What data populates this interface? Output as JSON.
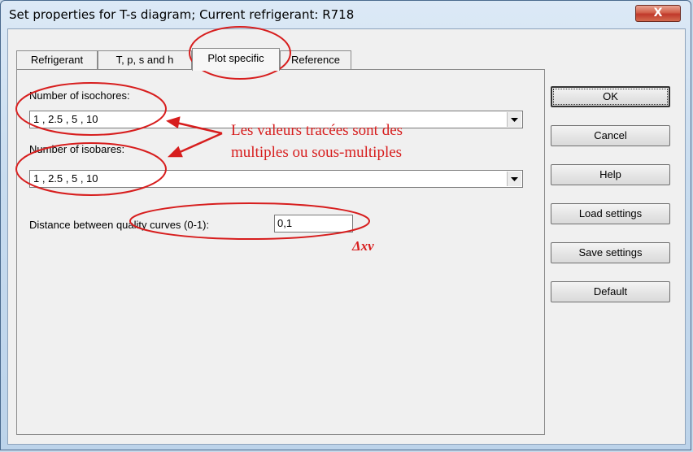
{
  "window": {
    "title": "Set properties for T-s diagram; Current refrigerant: R718",
    "close_glyph": "X"
  },
  "tabs": [
    {
      "label": "Refrigerant"
    },
    {
      "label": "T, p, s and h"
    },
    {
      "label": "Plot specific"
    },
    {
      "label": "Reference"
    }
  ],
  "panel": {
    "isochores_label": "Number of isochores:",
    "isochores_value": "1 , 2.5 , 5 , 10",
    "isobares_label": "Number of isobares:",
    "isobares_value": "1 , 2.5 , 5 , 10",
    "quality_label": "Distance between quality curves (0-1):",
    "quality_value": "0,1"
  },
  "buttons": {
    "ok": "OK",
    "cancel": "Cancel",
    "help": "Help",
    "load": "Load settings",
    "save": "Save settings",
    "default": "Default"
  },
  "annotations": {
    "line1": "Les valeurs tracées sont des",
    "line2": "multiples ou sous-multiples",
    "delta": "Δxv"
  },
  "colors": {
    "annotation": "#d71e1e"
  }
}
